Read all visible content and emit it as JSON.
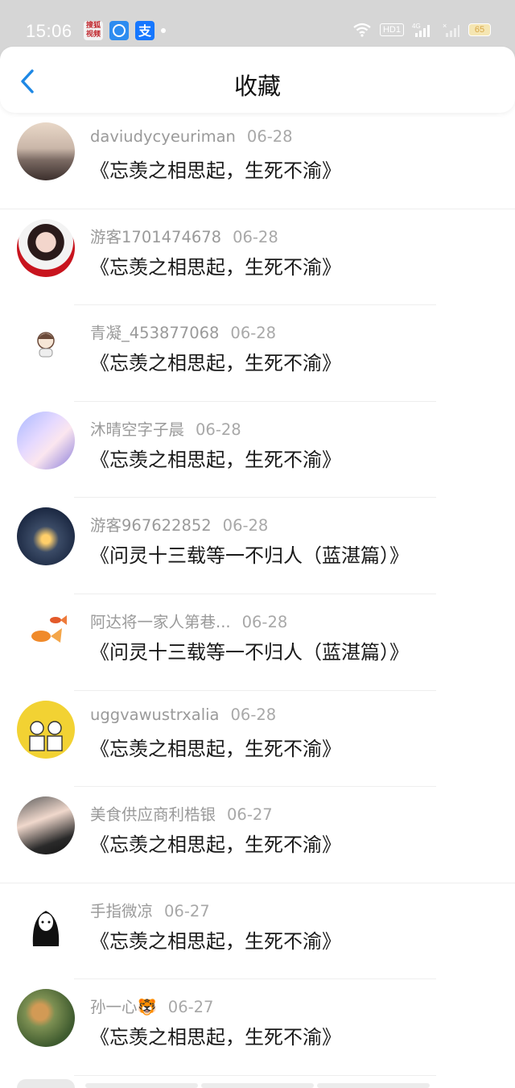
{
  "status_bar": {
    "time": "15:06",
    "apps": [
      "搜狐视频",
      "QQ",
      "支付宝"
    ],
    "network": "4G",
    "hd_label": "HD1",
    "battery": "65"
  },
  "header": {
    "title": "收藏",
    "back_icon": "chevron-left-icon",
    "accent_color": "#1e88e5"
  },
  "favorites": [
    {
      "user": "daviudycyeuriman",
      "date": "06-28",
      "work": "《忘羡之相思起，生死不渝》"
    },
    {
      "user": "游客1701474678",
      "date": "06-28",
      "work": "《忘羡之相思起，生死不渝》"
    },
    {
      "user": "青凝_453877068",
      "date": "06-28",
      "work": "《忘羡之相思起，生死不渝》"
    },
    {
      "user": "沐晴空字子晨",
      "date": "06-28",
      "work": "《忘羡之相思起，生死不渝》"
    },
    {
      "user": "游客967622852",
      "date": "06-28",
      "work": "《问灵十三载等一不归人（蓝湛篇）》"
    },
    {
      "user": "阿达将一家人第巷...",
      "date": "06-28",
      "work": "《问灵十三载等一不归人（蓝湛篇）》"
    },
    {
      "user": "uggvawustrxalia",
      "date": "06-28",
      "work": "《忘羡之相思起，生死不渝》"
    },
    {
      "user": "美食供应商利梏银",
      "date": "06-27",
      "work": "《忘羡之相思起，生死不渝》"
    },
    {
      "user": "手指微凉",
      "date": "06-27",
      "work": "《忘羡之相思起，生死不渝》"
    },
    {
      "user": "孙一心🐯",
      "date": "06-27",
      "work": "《忘羡之相思起，生死不渝》"
    }
  ]
}
